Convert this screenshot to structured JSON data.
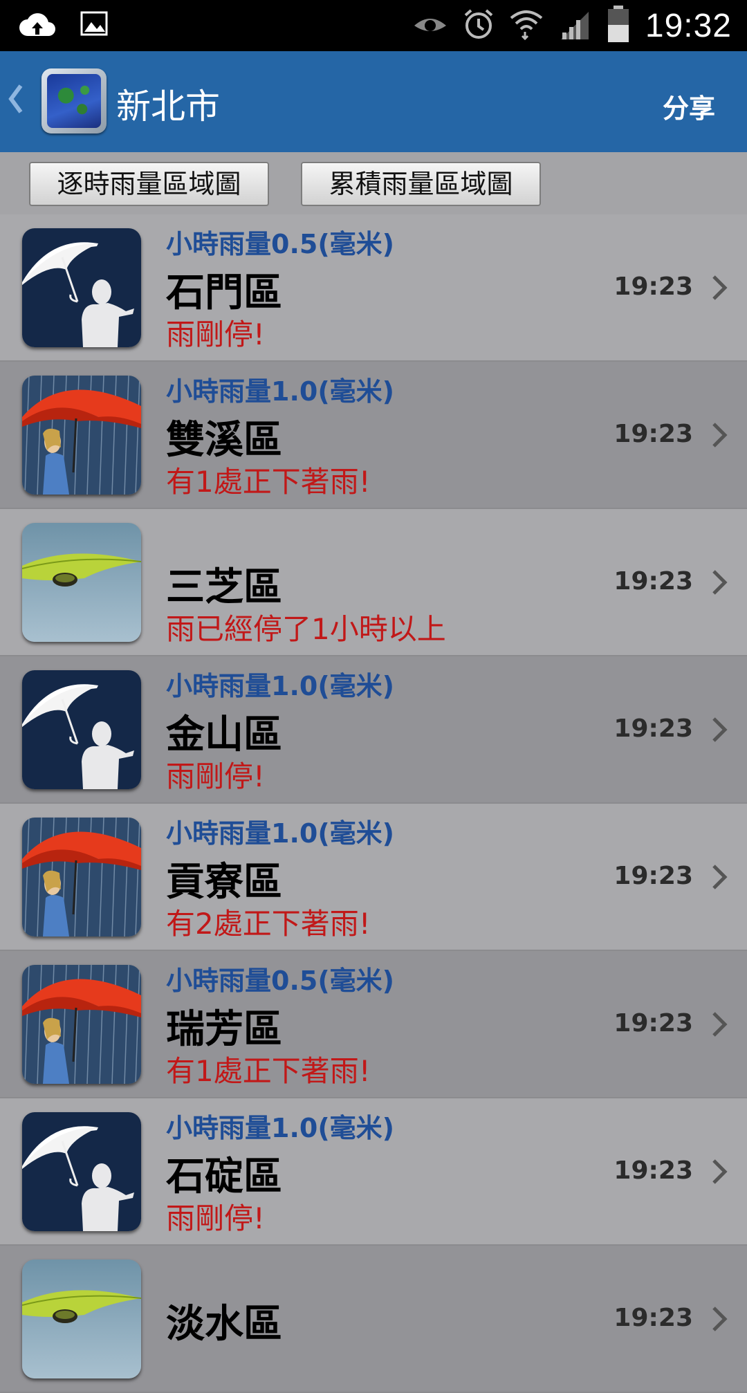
{
  "status_bar": {
    "time": "19:32",
    "icons": [
      "cloud-upload-icon",
      "image-icon",
      "eye-icon",
      "alarm-icon",
      "wifi-icon",
      "signal-icon",
      "battery-icon"
    ]
  },
  "header": {
    "title": "新北市",
    "share_label": "分享"
  },
  "buttons": {
    "hourly_map": "逐時雨量區域圖",
    "cumulative_map": "累積雨量區域圖"
  },
  "rows": [
    {
      "amount": "小時雨量0.5(毫米)",
      "name": "石門區",
      "status": "雨剛停!",
      "time": "19:23",
      "icon": "white-umbrella-icon"
    },
    {
      "amount": "小時雨量1.0(毫米)",
      "name": "雙溪區",
      "status": "有1處正下著雨!",
      "time": "19:23",
      "icon": "red-umbrella-rain-icon"
    },
    {
      "amount": "",
      "name": "三芝區",
      "status": "雨已經停了1小時以上",
      "time": "19:23",
      "icon": "leaf-drop-icon"
    },
    {
      "amount": "小時雨量1.0(毫米)",
      "name": "金山區",
      "status": "雨剛停!",
      "time": "19:23",
      "icon": "white-umbrella-icon"
    },
    {
      "amount": "小時雨量1.0(毫米)",
      "name": "貢寮區",
      "status": "有2處正下著雨!",
      "time": "19:23",
      "icon": "red-umbrella-rain-icon"
    },
    {
      "amount": "小時雨量0.5(毫米)",
      "name": "瑞芳區",
      "status": "有1處正下著雨!",
      "time": "19:23",
      "icon": "red-umbrella-rain-icon"
    },
    {
      "amount": "小時雨量1.0(毫米)",
      "name": "石碇區",
      "status": "雨剛停!",
      "time": "19:23",
      "icon": "white-umbrella-icon"
    },
    {
      "amount": "",
      "name": "淡水區",
      "status": "",
      "time": "19:23",
      "icon": "leaf-drop-icon"
    }
  ]
}
